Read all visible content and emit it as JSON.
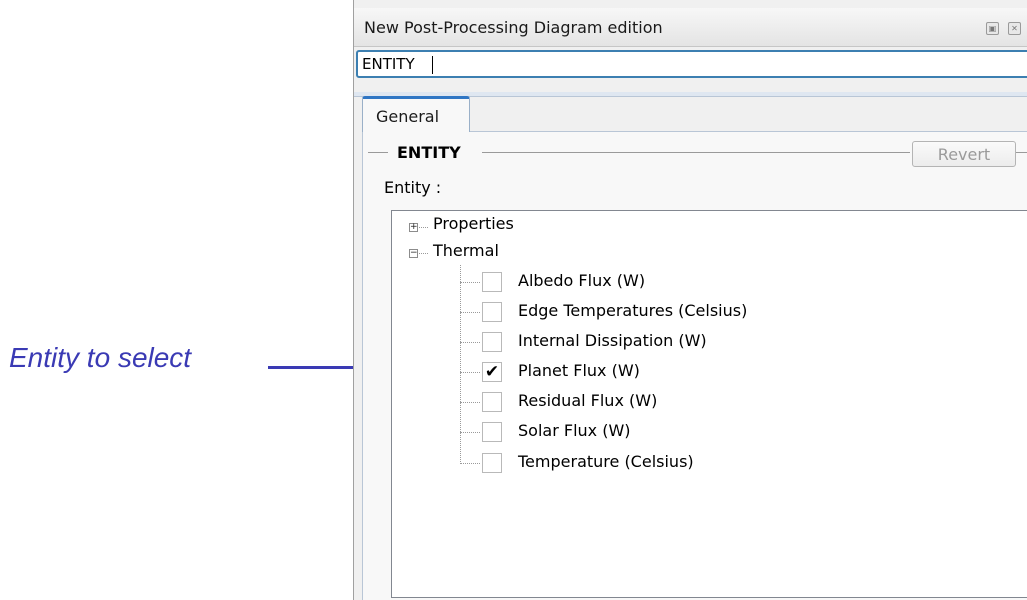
{
  "annotation": {
    "label": "Entity to select",
    "color": "#3a3ab4"
  },
  "panel": {
    "title": "New Post-Processing Diagram edition",
    "name_input": {
      "value": "ENTITY"
    },
    "tabs": [
      {
        "label": "General",
        "selected": true
      }
    ],
    "group": {
      "title": "ENTITY",
      "revert_label": "Revert",
      "revert_enabled": false,
      "entity_label": "Entity :"
    },
    "tree": [
      {
        "label": "Properties",
        "expanded": false
      },
      {
        "label": "Thermal",
        "expanded": true,
        "children": [
          {
            "label": "Albedo Flux (W)",
            "checked": false
          },
          {
            "label": "Edge Temperatures (Celsius)",
            "checked": false
          },
          {
            "label": "Internal Dissipation (W)",
            "checked": false
          },
          {
            "label": "Planet Flux (W)",
            "checked": true
          },
          {
            "label": "Residual Flux (W)",
            "checked": false
          },
          {
            "label": "Solar Flux (W)",
            "checked": false
          },
          {
            "label": "Temperature (Celsius)",
            "checked": false
          }
        ]
      }
    ]
  },
  "colors": {
    "tab_accent": "#2f76c4",
    "input_focus_border": "#3c7fb1"
  }
}
